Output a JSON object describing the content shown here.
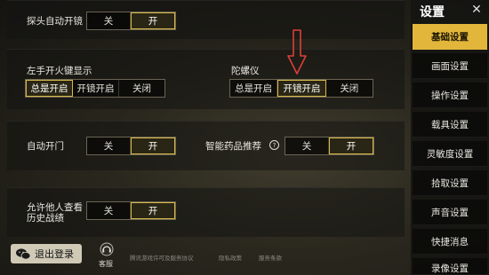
{
  "row1": {
    "label": "探头自动开镜",
    "off": "关",
    "on": "开",
    "selected": "on"
  },
  "row2": {
    "left_label": "左手开火键显示",
    "left_options": [
      "总是开启",
      "开镜开启",
      "关闭"
    ],
    "left_selected": 0,
    "right_label": "陀螺仪",
    "right_options": [
      "总是开启",
      "开镜开启",
      "关闭"
    ],
    "right_selected": 1
  },
  "row3": {
    "left_label": "自动开门",
    "left_off": "关",
    "left_on": "开",
    "right_label": "智能药品推荐",
    "help_icon": "?",
    "right_off": "关",
    "right_on": "开"
  },
  "row4": {
    "label_line1": "允许他人查看",
    "label_line2": "历史战绩",
    "off": "关",
    "on": "开"
  },
  "bottom": {
    "logout_label": "退出登录",
    "service_label": "客服",
    "links": [
      "腾讯游戏许可及服务协议",
      "隐私政策",
      "服务条款"
    ]
  },
  "sidebar": {
    "title": "设置",
    "active_index": 0,
    "items": [
      "基础设置",
      "画面设置",
      "操作设置",
      "载具设置",
      "灵敏度设置",
      "拾取设置",
      "声音设置",
      "快捷消息",
      "录像设置"
    ]
  },
  "colors": {
    "accent": "#e2b63a",
    "selected_border": "#d8b84a",
    "arrow": "#d9413a"
  },
  "icons": {
    "close": "close-icon",
    "wechat": "wechat-icon",
    "service": "customer-service-icon",
    "help": "help-icon",
    "arrow": "down-arrow-annotation"
  }
}
